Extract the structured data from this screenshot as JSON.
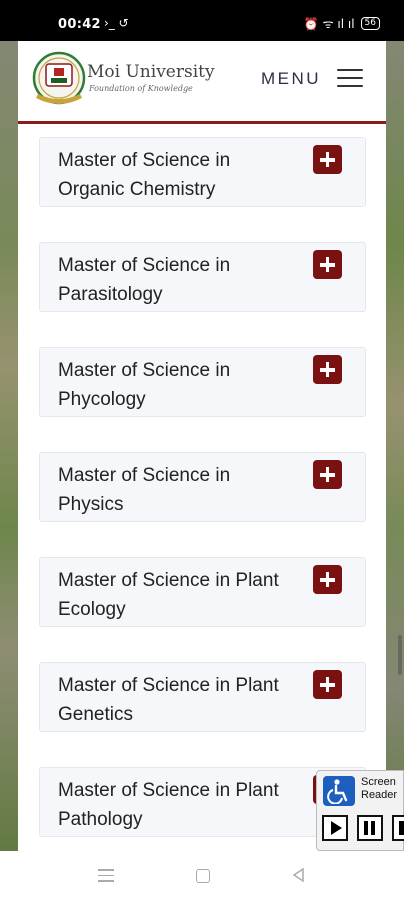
{
  "status_bar": {
    "time": "00:42",
    "left_icons": "›_ ↺",
    "right_icons": "⏰ ᯤ ıl ıl",
    "battery": "56"
  },
  "header": {
    "brand_name": "Moi University",
    "tagline": "Foundation of Knowledge",
    "menu_label": "MENU",
    "logo_icon": "university-crest-icon",
    "menu_icon": "hamburger-icon"
  },
  "programs": [
    {
      "title": "Master of Science in Organic Chemistry"
    },
    {
      "title": "Master of Science in Parasitology"
    },
    {
      "title": "Master of Science in Phycology"
    },
    {
      "title": "Master of Science in Physics"
    },
    {
      "title": "Master of Science in Plant Ecology"
    },
    {
      "title": "Master of Science in Plant Genetics"
    },
    {
      "title": "Master of Science in Plant Pathology"
    }
  ],
  "screen_reader_widget": {
    "label": "Screen Reader",
    "icon": "accessibility-icon",
    "controls": [
      "play",
      "pause",
      "stop"
    ]
  },
  "colors": {
    "brand_maroon": "#7a1212",
    "header_rule": "#8b1a1a",
    "card_background": "#f5f7fa",
    "menu_text": "#2b2f4a"
  }
}
